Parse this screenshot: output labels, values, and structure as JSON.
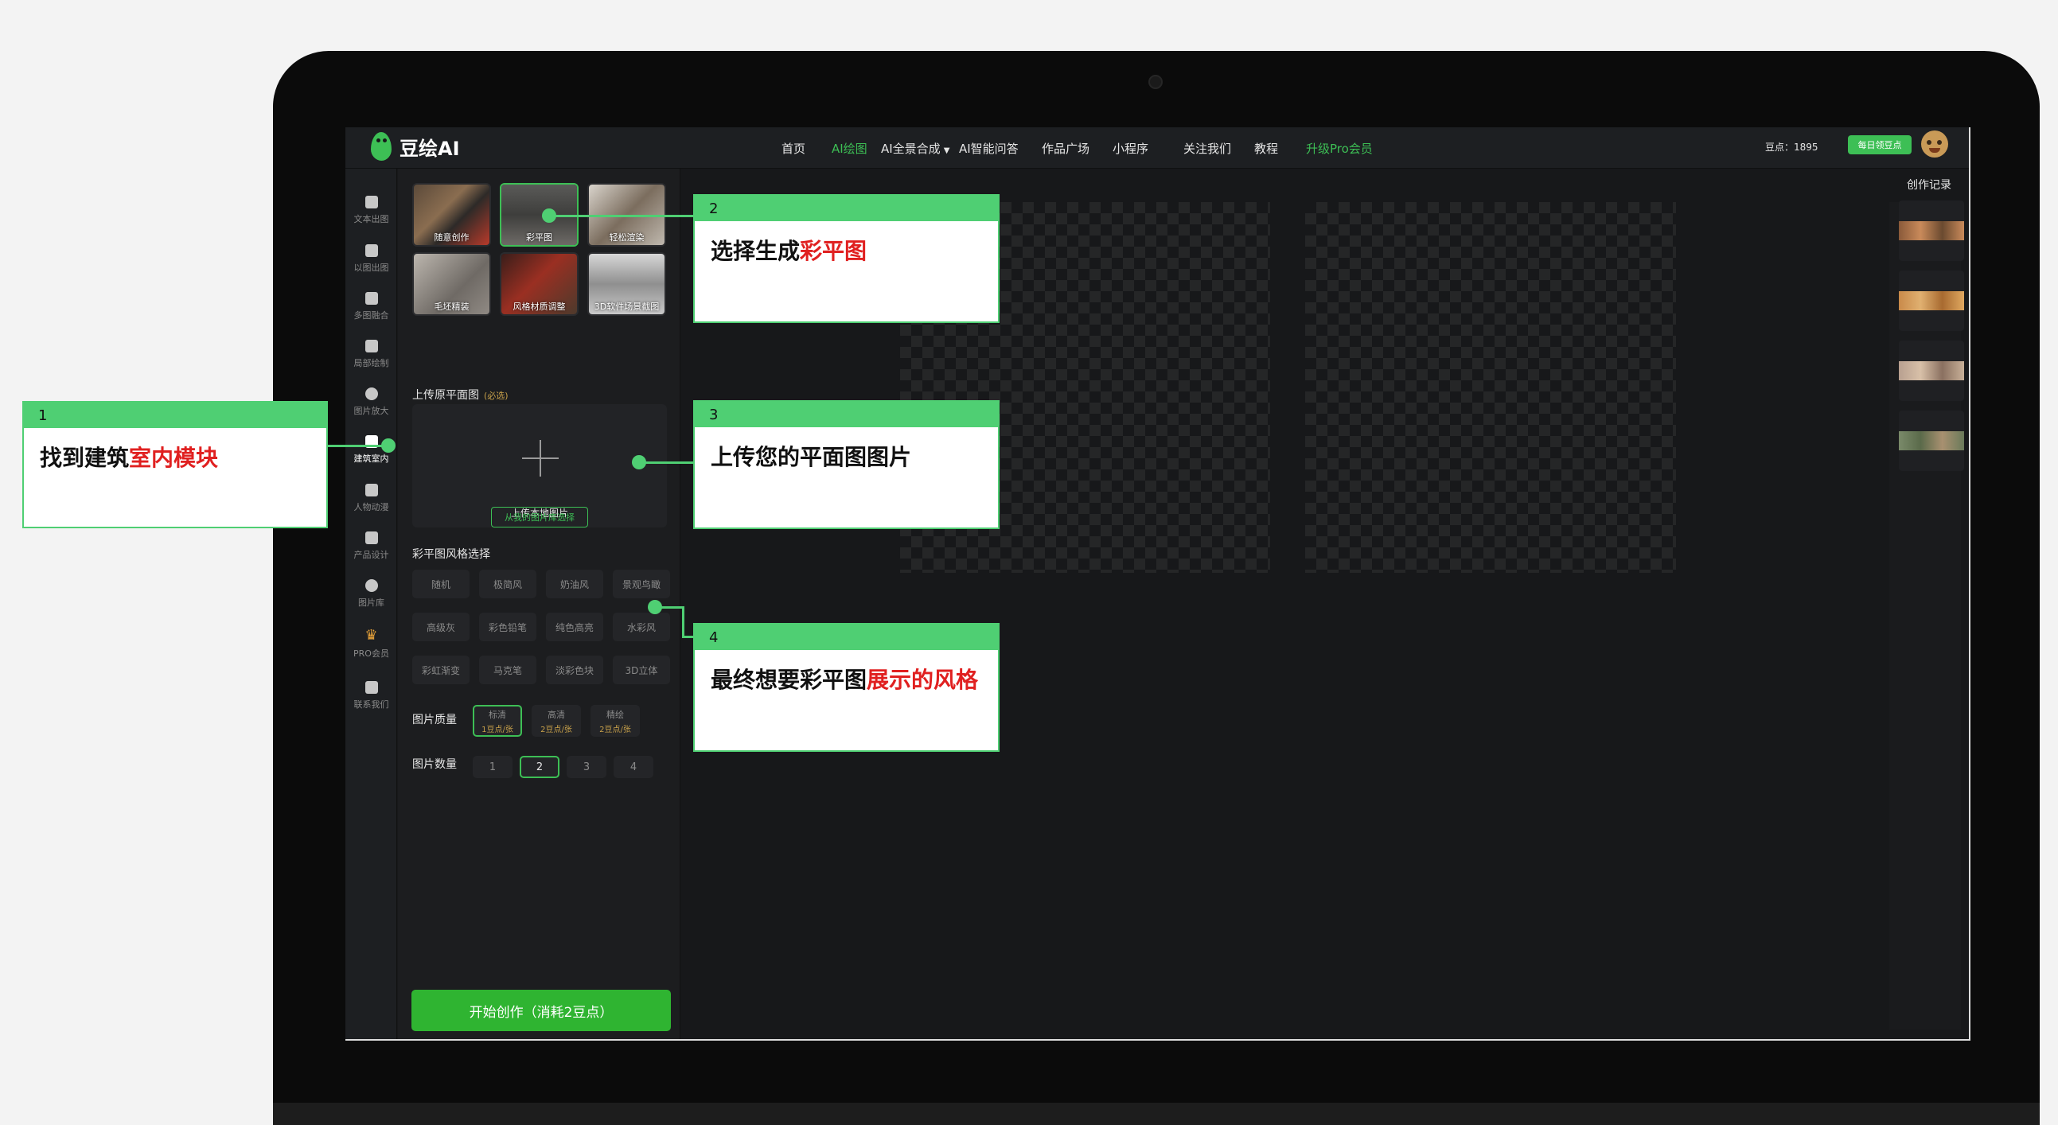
{
  "app": {
    "name": "豆绘AI",
    "nav": [
      {
        "label": "首页",
        "state": "normal"
      },
      {
        "label": "AI绘图",
        "state": "active"
      },
      {
        "label": "AI全景合成",
        "state": "dropdown"
      },
      {
        "label": "AI智能问答",
        "state": "normal"
      },
      {
        "label": "作品广场",
        "state": "normal"
      },
      {
        "label": "小程序",
        "state": "normal"
      },
      {
        "label": "关注我们",
        "state": "normal"
      },
      {
        "label": "教程",
        "state": "normal"
      },
      {
        "label": "升级Pro会员",
        "state": "pro"
      }
    ],
    "points_label": "豆点：1895",
    "daily_button": "每日领豆点",
    "accent_color": "#3dbf55"
  },
  "sidebar": {
    "items": [
      {
        "label": "文本出图",
        "icon": "document-icon"
      },
      {
        "label": "以图出图",
        "icon": "image-icon"
      },
      {
        "label": "多图融合",
        "icon": "chat-bubbles-icon"
      },
      {
        "label": "局部绘制",
        "icon": "paint-bucket-icon"
      },
      {
        "label": "图片放大",
        "icon": "magnifier-icon"
      },
      {
        "label": "建筑室内",
        "icon": "building-icon",
        "active": true
      },
      {
        "label": "人物动漫",
        "icon": "person-badge-icon"
      },
      {
        "label": "产品设计",
        "icon": "boxes-icon"
      },
      {
        "label": "图片库",
        "icon": "database-icon"
      },
      {
        "label": "PRO会员",
        "icon": "crown-icon"
      },
      {
        "label": "联系我们",
        "icon": "message-icon"
      }
    ]
  },
  "panel": {
    "modes": [
      {
        "label": "随意创作",
        "selected": false
      },
      {
        "label": "彩平图",
        "selected": true
      },
      {
        "label": "轻松渲染",
        "selected": false
      },
      {
        "label": "毛坯精装",
        "selected": false
      },
      {
        "label": "风格材质调整",
        "selected": false
      },
      {
        "label": "3D软件场景截图",
        "selected": false
      }
    ],
    "upload_title": "上传原平面图",
    "upload_required": "(必选)",
    "upload_text": "上传本地图片",
    "library_button": "从我的图片库选择",
    "style_title": "彩平图风格选择",
    "styles": [
      "随机",
      "极简风",
      "奶油风",
      "景观鸟瞰",
      "高级灰",
      "彩色铅笔",
      "纯色高亮",
      "水彩风",
      "彩虹渐变",
      "马克笔",
      "淡彩色块",
      "3D立体"
    ],
    "quality_title": "图片质量",
    "qualities": [
      {
        "name": "标清",
        "cost": "1豆点/张",
        "selected": true
      },
      {
        "name": "高清",
        "cost": "2豆点/张",
        "selected": false
      },
      {
        "name": "精绘",
        "cost": "2豆点/张",
        "selected": false
      }
    ],
    "count_title": "图片数量",
    "counts": [
      "1",
      "2",
      "3",
      "4"
    ],
    "count_selected": "2",
    "start_button": "开始创作（消耗2豆点）"
  },
  "history": {
    "title": "创作记录",
    "count": 4
  },
  "annotations": [
    {
      "num": "1",
      "text": "找到建筑",
      "highlight": "室内模块",
      "tail": ""
    },
    {
      "num": "2",
      "text": "选择生成",
      "highlight": "彩平图",
      "tail": ""
    },
    {
      "num": "3",
      "text": "上传您的平面图图片",
      "highlight": "",
      "tail": ""
    },
    {
      "num": "4",
      "text": "最终想要彩平图",
      "highlight": "展示的风格",
      "tail": ""
    }
  ],
  "colors": {
    "annotation_green": "#4fcf73",
    "highlight_red": "#e02020",
    "pro_gold": "#c7a04a"
  }
}
